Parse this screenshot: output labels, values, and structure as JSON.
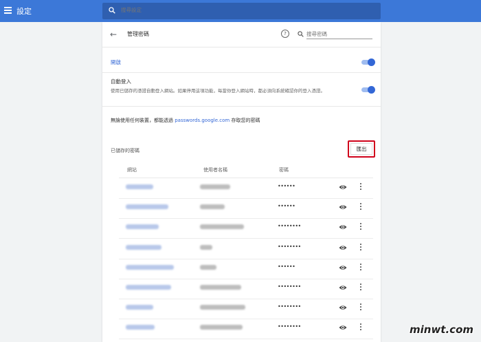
{
  "header": {
    "app_title": "設定",
    "search_placeholder": "搜尋設定"
  },
  "page": {
    "title": "管理密碼",
    "password_search_placeholder": "搜尋密碼"
  },
  "settings": {
    "enabled_label": "開啟",
    "enabled_on": true,
    "auto_signin_title": "自動登入",
    "auto_signin_desc": "使用已儲存的憑證自動登入網站。如果停用這項功能，每當你登入網站時，都必須向系統確認你的登入憑證。",
    "auto_signin_on": true,
    "sync_prefix": "無論使用任何裝置，都能透過 ",
    "sync_link": "passwords.google.com",
    "sync_suffix": " 存取您的密碼"
  },
  "saved": {
    "label": "已儲存的密碼",
    "export_label": "匯出",
    "columns": [
      "網站",
      "使用者名稱",
      "密碼"
    ],
    "rows": [
      {
        "password_mask": "••••••"
      },
      {
        "password_mask": "••••••"
      },
      {
        "password_mask": "••••••••"
      },
      {
        "password_mask": "••••••••"
      },
      {
        "password_mask": "••••••"
      },
      {
        "password_mask": "••••••••"
      },
      {
        "password_mask": "••••••••"
      },
      {
        "password_mask": "••••••••"
      }
    ]
  },
  "colors": {
    "topbar": "#3c78d8",
    "accent": "#3367d6",
    "export_highlight": "#d0021b"
  },
  "icons": [
    "menu-icon",
    "search-icon",
    "back-arrow-icon",
    "help-icon",
    "eye-icon",
    "more-vert-icon"
  ],
  "watermark": "minwt.com"
}
